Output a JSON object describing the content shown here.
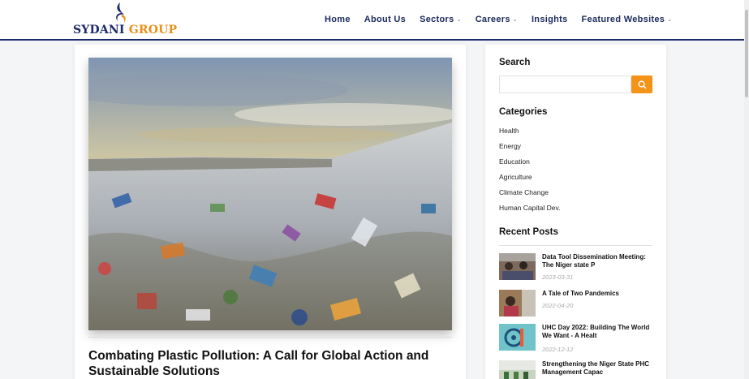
{
  "brand": {
    "part1": "SYDANI",
    "part2": "GROUP",
    "navy": "#1b2a6b",
    "orange": "#e8901a"
  },
  "nav": {
    "items": [
      {
        "label": "Home",
        "dropdown": false
      },
      {
        "label": "About Us",
        "dropdown": false
      },
      {
        "label": "Sectors",
        "dropdown": true
      },
      {
        "label": "Careers",
        "dropdown": true
      },
      {
        "label": "Insights",
        "dropdown": false
      },
      {
        "label": "Featured Websites",
        "dropdown": true
      }
    ]
  },
  "post": {
    "title": "Combating Plastic Pollution: A Call for Global Action and Sustainable Solutions",
    "image": "plastic-waste-landfill"
  },
  "sidebar": {
    "search_heading": "Search",
    "search_placeholder": "",
    "search_icon": "search-icon",
    "categories_heading": "Categories",
    "categories": [
      "Health",
      "Energy",
      "Education",
      "Agriculture",
      "Climate Change",
      "Human Capital Dev."
    ],
    "recent_heading": "Recent Posts",
    "recent_posts": [
      {
        "title": "Data Tool Dissemination Meeting: The Niger state P",
        "date": "2023-03-31"
      },
      {
        "title": "A Tale of Two Pandemics",
        "date": "2022-04-20"
      },
      {
        "title": "UHC Day 2022: Building The World We Want - A Healt",
        "date": "2022-12-12"
      },
      {
        "title": "Strengthening the Niger State PHC Management Capac",
        "date": ""
      }
    ]
  },
  "colors": {
    "accent": "#f39419",
    "nav_text": "#1b2a5e",
    "header_border": "#1a2a6c"
  }
}
